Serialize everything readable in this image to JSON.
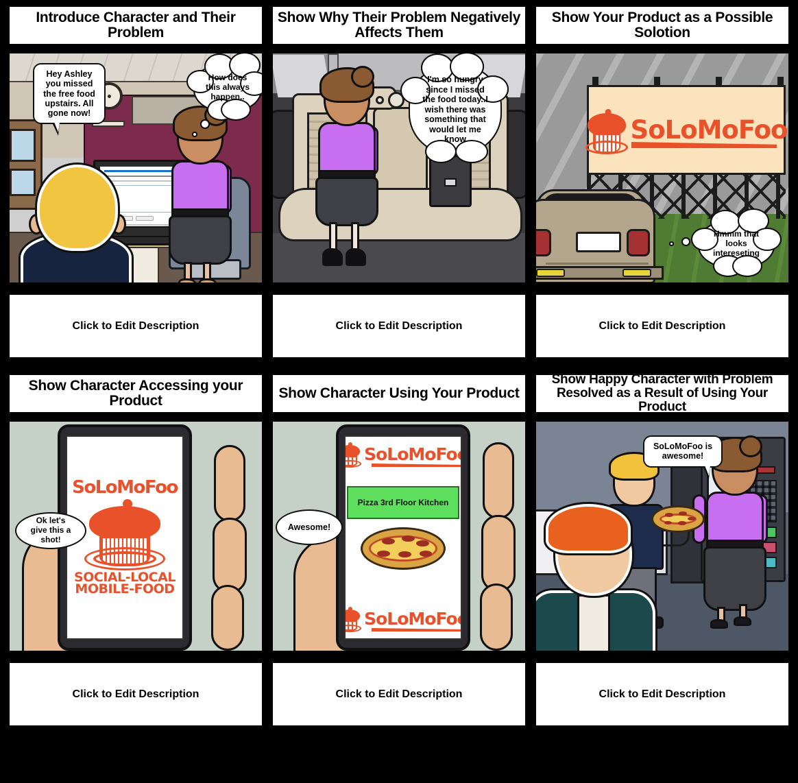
{
  "board": {
    "background_color": "#000000",
    "brand": {
      "name": "SoLoMoFoo",
      "tagline_line1": "SOCIAL-LOCAL",
      "tagline_line2": "MOBILE-FOOD",
      "accent_color": "#e8512a",
      "billboard_bg": "#fbe4bd"
    },
    "description_placeholder": "Click to Edit Description"
  },
  "cells": [
    {
      "id": "cell-1",
      "title": "Introduce Character and Their Problem",
      "description": "Click to Edit Description",
      "scene": "office-cubicle",
      "bubbles": [
        {
          "id": "bubble-coworker",
          "kind": "speech-rect",
          "text": "Hey Ashley you missed the free food upstairs. All gone now!"
        },
        {
          "id": "bubble-ashley-thought",
          "kind": "thought-cloud",
          "text": "How does this always happen.."
        }
      ]
    },
    {
      "id": "cell-2",
      "title": "Show Why Their Problem Negatively Affects Them",
      "description": "Click to Edit Description",
      "scene": "car-interior",
      "bubbles": [
        {
          "id": "bubble-hungry-thought",
          "kind": "thought-cloud",
          "text": "I'm so hungry since I missed the food today..I wish there was something that would let me know"
        }
      ]
    },
    {
      "id": "cell-3",
      "title": "Show Your Product as a Possible Solotion",
      "description": "Click to Edit Description",
      "scene": "billboard-roadside",
      "billboard_text": "SoLoMoFoo",
      "bubbles": [
        {
          "id": "bubble-interesting-thought",
          "kind": "thought-cloud",
          "text": "Hmmm that looks intereseting"
        }
      ]
    },
    {
      "id": "cell-4",
      "title": "Show Character Accessing your Product",
      "description": "Click to Edit Description",
      "scene": "phone-in-hand-app-splash",
      "phone_screen": {
        "logo_word": "SoLoMoFoo",
        "tagline_line1": "SOCIAL-LOCAL",
        "tagline_line2": "MOBILE-FOOD"
      },
      "bubbles": [
        {
          "id": "bubble-give-a-shot",
          "kind": "speech-oval",
          "text": "Ok let's give this a shot!"
        }
      ]
    },
    {
      "id": "cell-5",
      "title": "Show Character Using Your Product",
      "description": "Click to Edit Description",
      "scene": "phone-in-hand-notification",
      "phone_screen": {
        "header_logo": "SoLoMoFoo",
        "notification_banner": "Pizza 3rd Floor Kitchen",
        "footer_logo": "SoLoMoFoo",
        "banner_color": "#5ee05e"
      },
      "bubbles": [
        {
          "id": "bubble-awesome",
          "kind": "speech-oval",
          "text": "Awesome!"
        }
      ]
    },
    {
      "id": "cell-6",
      "title": "Show Happy Character with Problem Resolved as a Result of Using Your Product",
      "description": "Click to Edit Description",
      "scene": "break-room-pizza",
      "bubbles": [
        {
          "id": "bubble-solomofoo-awesome",
          "kind": "speech-rect",
          "text": "SoLoMoFoo is awesome!"
        }
      ]
    }
  ]
}
